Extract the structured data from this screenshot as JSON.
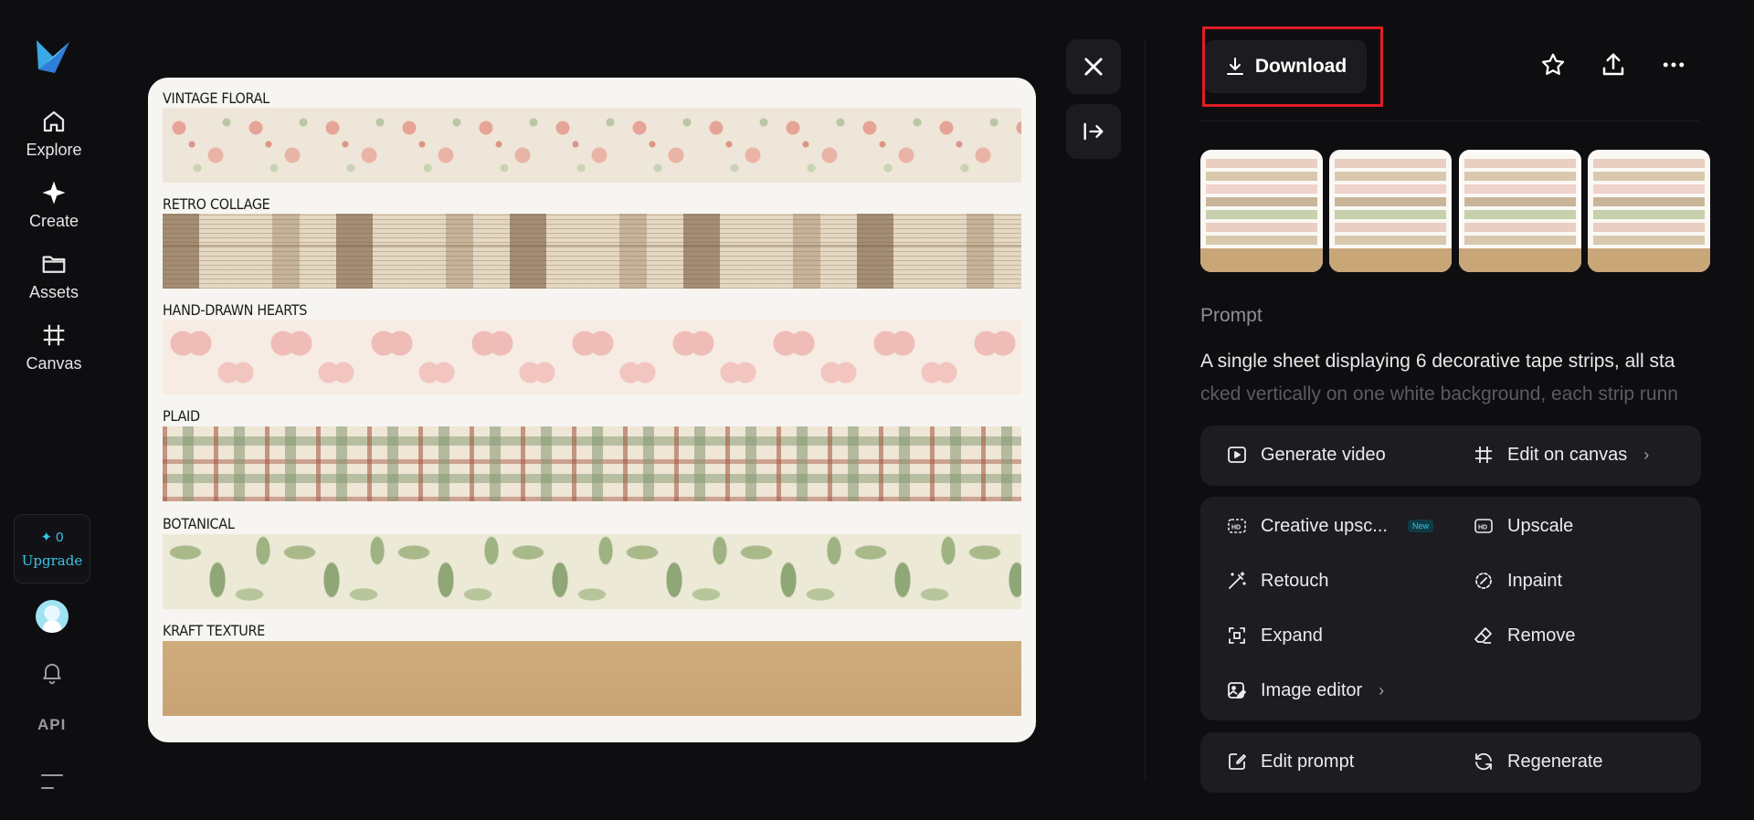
{
  "nav": {
    "explore": "Explore",
    "create": "Create",
    "assets": "Assets",
    "canvas": "Canvas"
  },
  "account": {
    "credits": "0",
    "upgrade": "Upgrade",
    "api": "API"
  },
  "image": {
    "strips": [
      {
        "label": "VINTAGE FLORAL",
        "icon": "floral-pattern"
      },
      {
        "label": "RETRO COLLAGE",
        "icon": "newspaper-collage-pattern"
      },
      {
        "label": "HAND-DRAWN HEARTS",
        "icon": "hearts-pattern"
      },
      {
        "label": "PLAID",
        "icon": "plaid-pattern"
      },
      {
        "label": "BOTANICAL",
        "icon": "leaf-pattern"
      },
      {
        "label": "KRAFT TEXTURE",
        "icon": "kraft-paper-texture"
      }
    ]
  },
  "toolbar": {
    "download": "Download"
  },
  "prompt": {
    "label": "Prompt",
    "text_visible": "A single sheet displaying 6 decorative tape strips, all sta",
    "text_faded": "cked vertically on one white background, each strip runn"
  },
  "actions": {
    "generate_video": "Generate video",
    "edit_on_canvas": "Edit on canvas",
    "creative_upscale": "Creative upsc...",
    "new_badge": "New",
    "upscale": "Upscale",
    "retouch": "Retouch",
    "inpaint": "Inpaint",
    "expand": "Expand",
    "remove": "Remove",
    "image_editor": "Image editor",
    "edit_prompt": "Edit prompt",
    "regenerate": "Regenerate"
  },
  "colors": {
    "background": "#0e0e11",
    "panel": "#1c1c21",
    "accent": "#35c6e8",
    "highlight": "#e01d26"
  }
}
